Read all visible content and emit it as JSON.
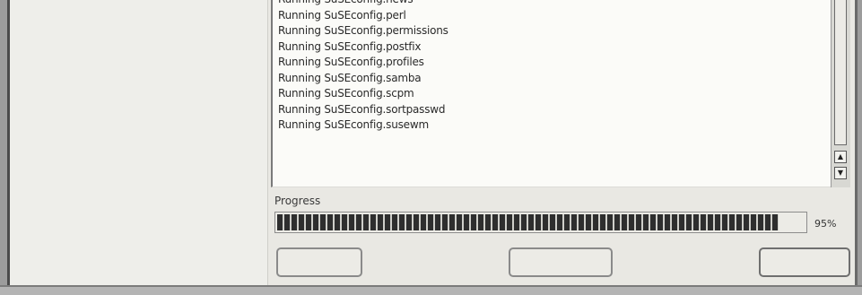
{
  "log": {
    "lines": [
      "Running SuSEconfig.news",
      "Running SuSEconfig.perl",
      "Running SuSEconfig.permissions",
      "Running SuSEconfig.postfix",
      "Running SuSEconfig.profiles",
      "Running SuSEconfig.samba",
      "Running SuSEconfig.scpm",
      "Running SuSEconfig.sortpasswd",
      "Running SuSEconfig.susewm"
    ]
  },
  "progress": {
    "label": "Progress",
    "value": 95,
    "percent_text": "95%"
  },
  "buttons": {
    "left_label": "",
    "middle_label": "",
    "right_label": ""
  },
  "icons": {
    "scroll_up": "arrow-up-icon",
    "scroll_down": "arrow-down-icon"
  }
}
